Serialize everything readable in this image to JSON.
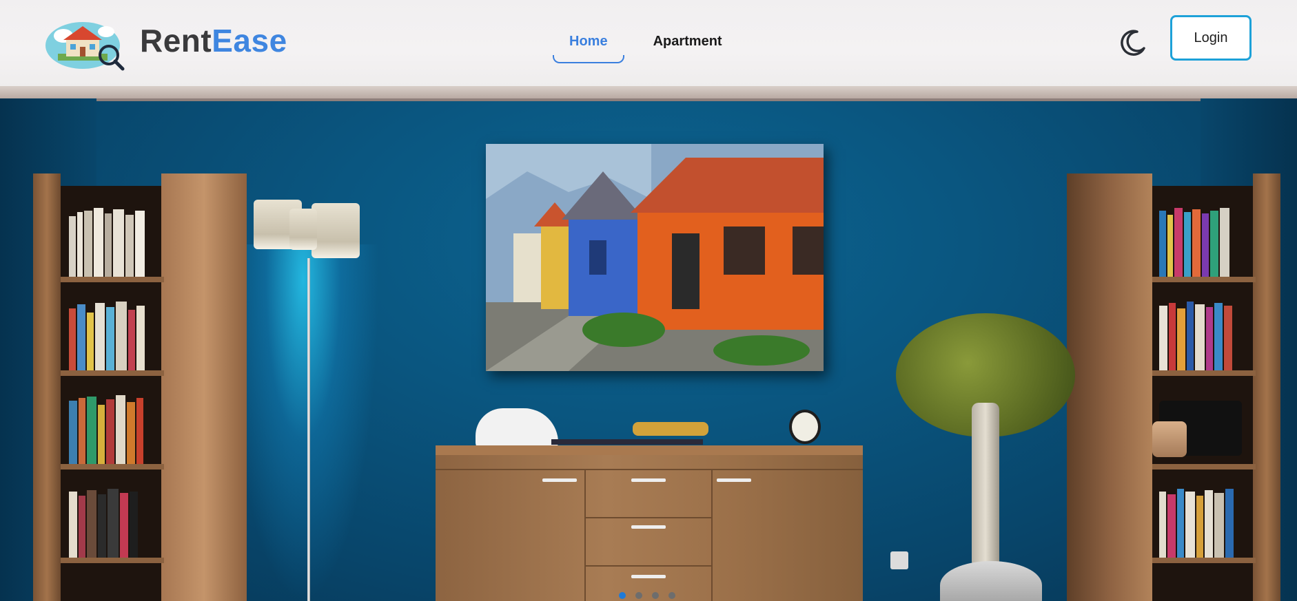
{
  "brand": {
    "name_part1": "Rent",
    "name_part2": "Ease",
    "logo_icon": "house-magnifier-logo"
  },
  "nav": {
    "items": [
      {
        "label": "Home",
        "active": true
      },
      {
        "label": "Apartment",
        "active": false
      }
    ]
  },
  "header_actions": {
    "theme_toggle_icon": "moon-icon",
    "login_label": "Login"
  },
  "carousel": {
    "slide_count": 4,
    "active_index": 0
  },
  "colors": {
    "brand_blue": "#3f86e0",
    "brand_dark": "#3a3a3c",
    "login_border": "#1da1d8",
    "active_dot": "#1e7ad8"
  }
}
